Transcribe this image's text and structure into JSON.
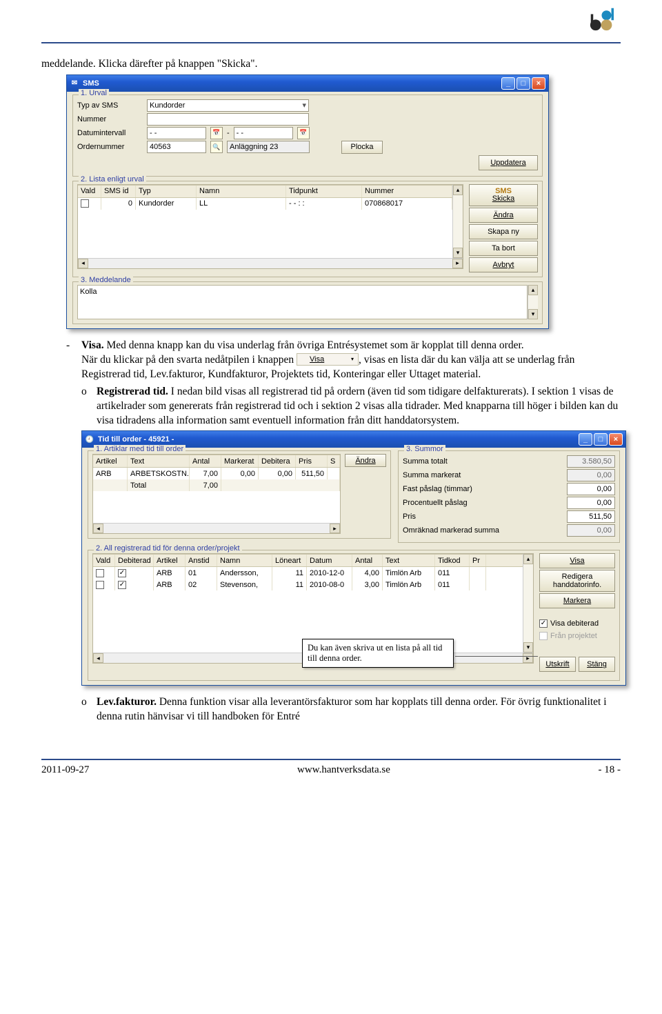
{
  "intro_line": "meddelande. Klicka därefter på knappen \"Skicka\".",
  "sms_win": {
    "title": "SMS",
    "sec1": "1. Urval",
    "typ": "Typ av SMS",
    "typ_val": "Kundorder",
    "num": "Nummer",
    "di": "Datumintervall",
    "di_v1": "- -",
    "di_v2": "- -",
    "on": "Ordernummer",
    "on_v": "40563",
    "anl": "Anläggning 23",
    "plocka": "Plocka",
    "uppdatera": "Uppdatera",
    "sec2": "2. Lista enligt urval",
    "hdr": {
      "vald": "Vald",
      "sms": "SMS id",
      "typ": "Typ",
      "namn": "Namn",
      "tid": "Tidpunkt",
      "nr": "Nummer"
    },
    "row": {
      "sms": "0",
      "typ": "Kundorder",
      "namn": "LL",
      "tid": "- -    : :",
      "nr": "070868017"
    },
    "skicka": "Skicka",
    "andra": "Ändra",
    "skapany": "Skapa ny",
    "tabort": "Ta bort",
    "avbryt": "Avbryt",
    "sms_btn": "SMS",
    "sec3": "3. Meddelande",
    "msg": "Kolla"
  },
  "visa_btn_label": "Visa",
  "para": {
    "p1a": "Visa.",
    "p1b": " Med denna knapp kan du visa underlag från övriga Entrésystemet som är kopplat till denna order.",
    "p2a": "När du klickar på den svarta nedåtpilen i knappen ",
    "p2b": ", visas en lista där du kan välja att se underlag från Registrerad tid, Lev.fakturor, Kundfakturor, Projektets tid, Konteringar eller Uttaget material.",
    "rt_a": "Registrerad tid.",
    "rt_b": " I nedan bild visas all registrerad tid på ordern (även tid som tidigare delfakturerats). I sektion 1 visas de artikelrader som genererats från registrerad tid och i sektion 2 visas alla tidrader. Med knapparna till höger i bilden kan du visa tidradens alla information samt eventuell information från ditt handdatorsystem.",
    "lf_a": "Lev.fakturor.",
    "lf_b": " Denna funktion visar alla leverantörsfakturor som har kopplats till denna order. För övrig funktionalitet i denna rutin hänvisar vi till handboken för Entré"
  },
  "tid_win": {
    "title": "Tid till order - 45921 -",
    "sec1": "1. Artiklar med tid till order",
    "sec3": "3. Summor",
    "hdr1": {
      "art": "Artikel",
      "text": "Text",
      "ant": "Antal",
      "mark": "Markerat",
      "deb": "Debitera",
      "pris": "Pris",
      "s": "S"
    },
    "row1": {
      "art": "ARB",
      "text": "ARBETSKOSTN.",
      "ant": "7,00",
      "mark": "0,00",
      "deb": "0,00",
      "pris": "511,50"
    },
    "total_l": "Total",
    "total_v": "7,00",
    "andra": "Ändra",
    "sum": {
      "tot": "Summa totalt",
      "tot_v": "3.580,50",
      "mar": "Summa markerat",
      "mar_v": "0,00",
      "fp": "Fast påslag (timmar)",
      "fp_v": "0,00",
      "pp": "Procentuellt påslag",
      "pp_v": "0,00",
      "pr": "Pris",
      "pr_v": "511,50",
      "om": "Omräknad markerad summa",
      "om_v": "0,00"
    },
    "sec2": "2. All registrerad tid för denna order/projekt",
    "hdr2": {
      "vald": "Vald",
      "deb": "Debiterad",
      "art": "Artikel",
      "anstid": "Anstid",
      "namn": "Namn",
      "lon": "Löneart",
      "dat": "Datum",
      "ant": "Antal",
      "txt": "Text",
      "tk": "Tidkod",
      "pr": "Pr"
    },
    "rows2": [
      {
        "deb": "✓",
        "art": "ARB",
        "anstid": "01",
        "namn": "Andersson,",
        "lon": "11",
        "dat": "2010-12-0",
        "ant": "4,00",
        "txt": "Timlön Arb",
        "tk": "011"
      },
      {
        "deb": "✓",
        "art": "ARB",
        "anstid": "02",
        "namn": "Stevenson,",
        "lon": "11",
        "dat": "2010-08-0",
        "ant": "3,00",
        "txt": "Timlön Arb",
        "tk": "011"
      }
    ],
    "visa": "Visa",
    "red": "Redigera handdatorinfo.",
    "markera": "Markera",
    "chk_vd": "Visa debiterad",
    "chk_fp": "Från projektet",
    "utskrift": "Utskrift",
    "stang": "Stäng"
  },
  "callout": "Du kan även skriva ut en lista på all tid till denna order.",
  "footer": {
    "date": "2011-09-27",
    "url": "www.hantverksdata.se",
    "page": "- 18 -"
  }
}
